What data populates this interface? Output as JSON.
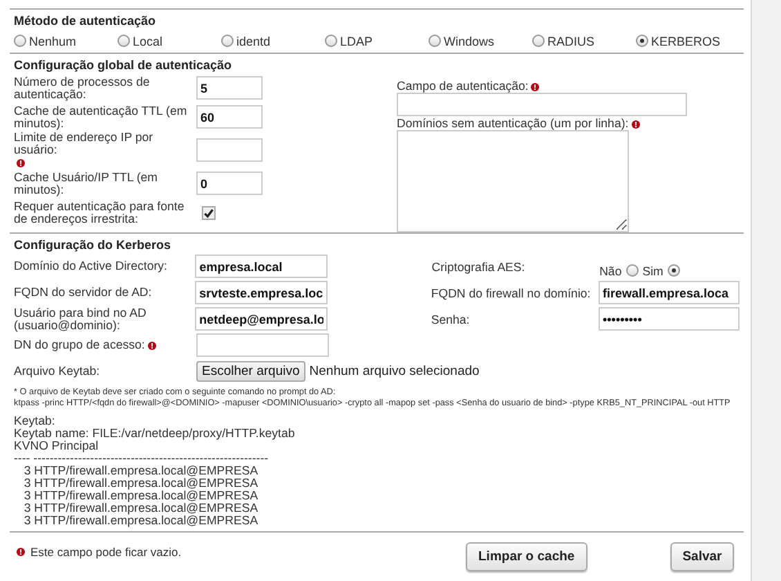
{
  "auth_method": {
    "title": "Método de autenticação",
    "options": [
      {
        "label": "Nenhum",
        "selected": false
      },
      {
        "label": "Local",
        "selected": false
      },
      {
        "label": "identd",
        "selected": false
      },
      {
        "label": "LDAP",
        "selected": false
      },
      {
        "label": "Windows",
        "selected": false
      },
      {
        "label": "RADIUS",
        "selected": false
      },
      {
        "label": "KERBEROS",
        "selected": true
      }
    ]
  },
  "global_config": {
    "title": "Configuração global de autenticação",
    "fields": [
      {
        "kind": "text",
        "label": "Número de processos de autenticação:",
        "value": "5",
        "warning": false
      },
      {
        "kind": "text",
        "label": "Cache de autenticação TTL (em minutos):",
        "value": "60",
        "warning": false
      },
      {
        "kind": "text",
        "label": "Limite de endereço IP por usuário:",
        "warning": true
      },
      {
        "kind": "text",
        "label": "Cache Usuário/IP TTL (em minutos):",
        "value": "0",
        "warning": false
      },
      {
        "kind": "checkbox",
        "label": "Requer autenticação para fonte de endereços irrestrita:",
        "checked": true,
        "warning": false
      }
    ],
    "auth_field": {
      "label": "Campo de autenticação:",
      "warning": true
    },
    "domains": {
      "label": "Domínios sem autenticação (um por linha):",
      "warning": true
    }
  },
  "kerberos": {
    "title": "Configuração do Kerberos",
    "rows": [
      {
        "left": {
          "kind": "text",
          "label": "Domínio do Active Directory:",
          "value": "empresa.local",
          "warning": false
        },
        "right": {
          "kind": "radio",
          "label": "Criptografia AES:",
          "options": [
            {
              "label": "Não",
              "selected": false
            },
            {
              "label": "Sim",
              "selected": true
            }
          ]
        }
      },
      {
        "left": {
          "kind": "text",
          "label": "FQDN do servidor de AD:",
          "value": "srvteste.empresa.loc",
          "warning": false
        },
        "right": {
          "kind": "text",
          "label": "FQDN do firewall no domínio:",
          "value": "firewall.empresa.loca"
        }
      },
      {
        "left": {
          "kind": "text",
          "label": "Usuário para bind no AD (usuario@dominio):",
          "value": "netdeep@empresa.lo",
          "warning": false
        },
        "right": {
          "kind": "text",
          "label": "Senha:",
          "value": "•••••••••"
        }
      },
      {
        "left": {
          "kind": "text",
          "label": "DN do grupo de acesso:",
          "warning": true
        }
      },
      {
        "left": {
          "kind": "file",
          "label": "Arquivo Keytab:",
          "button": "Escolher arquivo",
          "status": "Nenhum arquivo selecionado",
          "warning": false
        }
      }
    ],
    "note": "* O arquivo de Keytab deve ser criado com o seguinte comando no prompt do AD:",
    "command": "ktpass -princ HTTP/<fqdn do firewall>@<DOMINIO> -mapuser <DOMINIO\\usuario> -crypto all -mapop set -pass <Senha do usuario de bind> -ptype KRB5_NT_PRINCIPAL -out HTTP",
    "keytab_lines": [
      "Keytab:",
      "Keytab name: FILE:/var/netdeep/proxy/HTTP.keytab",
      "KVNO Principal",
      "---- ----------------------------------------------------------",
      "   3 HTTP/firewall.empresa.local@EMPRESA",
      "   3 HTTP/firewall.empresa.local@EMPRESA",
      "   3 HTTP/firewall.empresa.local@EMPRESA",
      "   3 HTTP/firewall.empresa.local@EMPRESA",
      "   3 HTTP/firewall.empresa.local@EMPRESA"
    ]
  },
  "footer": {
    "legend": "Este campo pode ficar vazio.",
    "buttons": [
      "Limpar o cache",
      "Salvar"
    ]
  }
}
